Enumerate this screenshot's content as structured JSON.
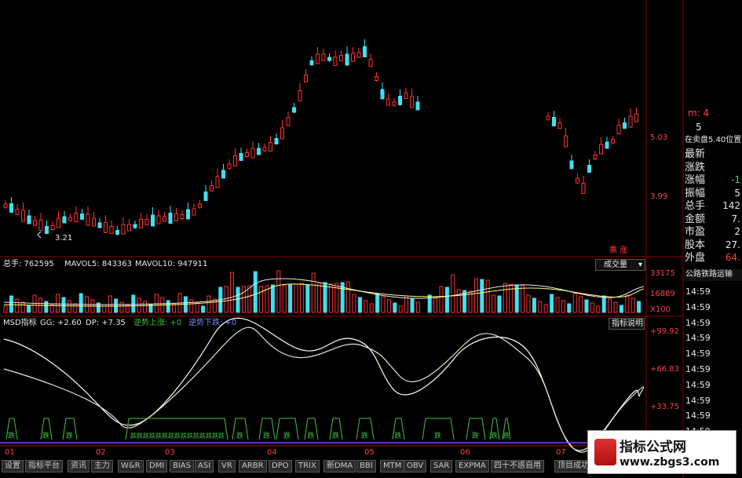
{
  "price_panel": {
    "low_label": "3.21",
    "axis": {
      "upper": "5.03",
      "lower": "3.99"
    },
    "market_tag": "票 涨"
  },
  "volume_panel": {
    "total_label": "总手: 762595",
    "mavol5_label": "MAVOL5: 843363",
    "mavol10_label": "MAVOL10: 947911",
    "axis": {
      "upper": "33175",
      "mid": "16889",
      "unit": "X100"
    },
    "dropdown_label": "成交量"
  },
  "msd_panel": {
    "name": "MSD指标",
    "gg": "GG: +2.60",
    "dp": "DP: +7.35",
    "trend_up": "逆势上涨: +0",
    "trend_down": "逆势下跌: +0",
    "explain_button": "指标说明",
    "axis": {
      "a": "+99.92",
      "b": "+66.83",
      "c": "+33.75"
    },
    "signal_char": "跌"
  },
  "x_axis": [
    "01",
    "02",
    "03",
    "04",
    "05",
    "06",
    "07"
  ],
  "right_info": {
    "top_a": "m: 4",
    "top_b": "5",
    "header": "在卖盘5.40位置",
    "rows": [
      {
        "label": "最新",
        "value": ""
      },
      {
        "label": "涨跌",
        "value": ""
      },
      {
        "label": "涨幅",
        "value": "-1"
      },
      {
        "label": "振幅",
        "value": "5"
      },
      {
        "label": "总手",
        "value": "142"
      },
      {
        "label": "金额",
        "value": "7."
      },
      {
        "label": "市盈",
        "value": "2"
      },
      {
        "label": "股本",
        "value": "27."
      },
      {
        "label": "外盘",
        "value": "64."
      }
    ],
    "route_label": "公路铁路运输",
    "times": [
      "14:59",
      "14:59",
      "14:59",
      "14:59",
      "14:59",
      "14:59",
      "14:59",
      "14:59",
      "14:59",
      "14:59",
      "14:59",
      "14:59"
    ]
  },
  "tabs": [
    "设置",
    "指标平台",
    "资讯",
    "主力",
    "W&R",
    "DMI",
    "BIAS",
    "ASI",
    "VR",
    "ARBR",
    "DPO",
    "TRIX",
    "新DMA",
    "BBI",
    "MTM",
    "OBV",
    "SAR",
    "EXPMA",
    "四十不惑自用",
    "顶目成功"
  ],
  "watermark": {
    "title": "指标公式网",
    "url": "www.zbgs3.com"
  },
  "colors": {
    "up": "#ff3030",
    "down": "#40e0f0",
    "line": "#ffffff",
    "signal": "#40c040",
    "axis": "#8b0000",
    "purple": "#8040ff"
  }
}
